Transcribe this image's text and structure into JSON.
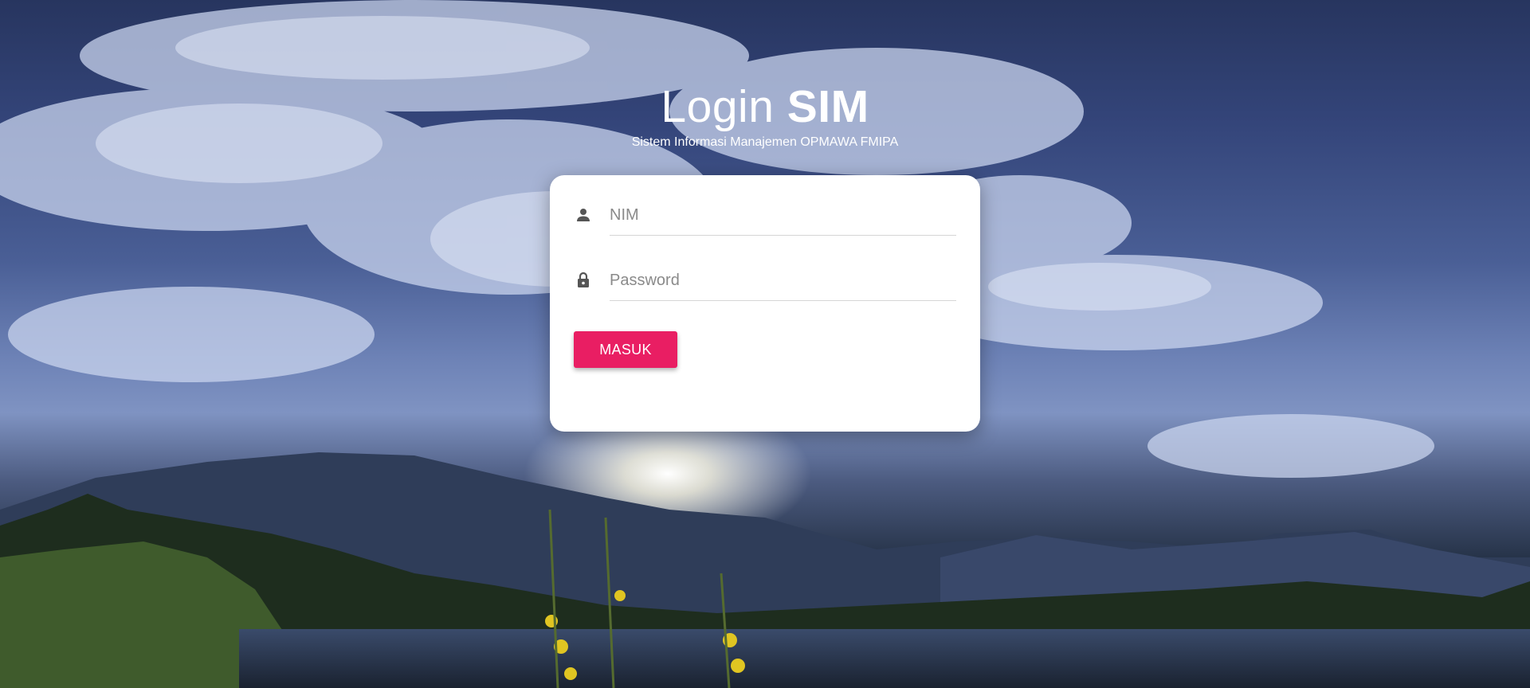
{
  "header": {
    "title_light": "Login",
    "title_bold": "SIM",
    "subtitle": "Sistem Informasi Manajemen OPMAWA FMIPA"
  },
  "form": {
    "nim": {
      "placeholder": "NIM",
      "value": "",
      "icon": "person-icon"
    },
    "password": {
      "placeholder": "Password",
      "value": "",
      "icon": "lock-icon"
    },
    "submit_label": "MASUK"
  },
  "colors": {
    "accent": "#e91e63",
    "card": "#ffffff",
    "icon": "#555555"
  }
}
